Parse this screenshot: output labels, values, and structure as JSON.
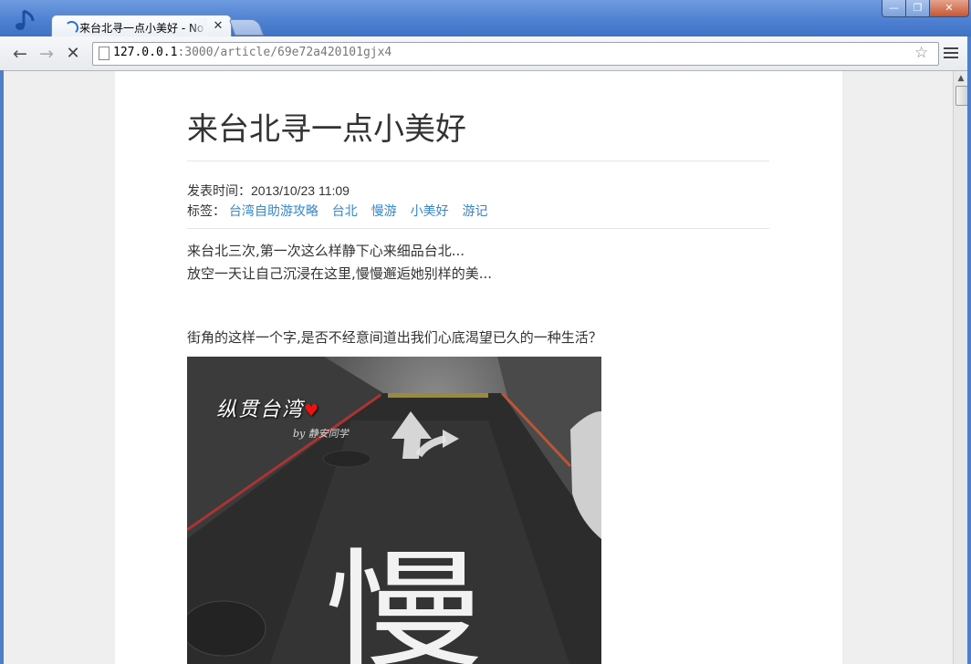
{
  "window": {
    "tab_title": "来台北寻一点小美好 - Nodeblog",
    "minimize_glyph": "—",
    "maximize_glyph": "❐",
    "close_glyph": "✕",
    "tab_close_glyph": "✕"
  },
  "toolbar": {
    "back_glyph": "←",
    "forward_glyph": "→",
    "stop_glyph": "✕",
    "url_host": "127.0.0.1",
    "url_rest": ":3000/article/69e72a420101gjx4",
    "bookmark_glyph": "☆"
  },
  "article": {
    "title": "来台北寻一点小美好",
    "published_label": "发表时间：",
    "published_value": "2013/10/23 11:09",
    "tags_label": "标签：",
    "tags": [
      "台湾自助游攻略",
      "台北",
      "慢游",
      "小美好",
      "游记"
    ],
    "paragraphs": [
      "来台北三次,第一次这么样静下心来细品台北...",
      "放空一天让自己沉浸在这里,慢慢邂逅她别样的美...",
      "街角的这样一个字,是否不经意间道出我们心底渴望已久的一种生活？"
    ],
    "photo": {
      "watermark": "纵贯台湾",
      "watermark_sub": "by 静安同学",
      "road_marking": "慢"
    }
  },
  "scrollbar": {
    "up_glyph": "▲"
  },
  "icons": {
    "app": "music-note-icon",
    "page": "page-icon",
    "menu": "hamburger-menu-icon",
    "loading": "loading-spinner-icon"
  },
  "colors": {
    "frame": "#4f7fc9",
    "link": "#3a86c8",
    "text": "#333333",
    "page_bg": "#efefef"
  }
}
